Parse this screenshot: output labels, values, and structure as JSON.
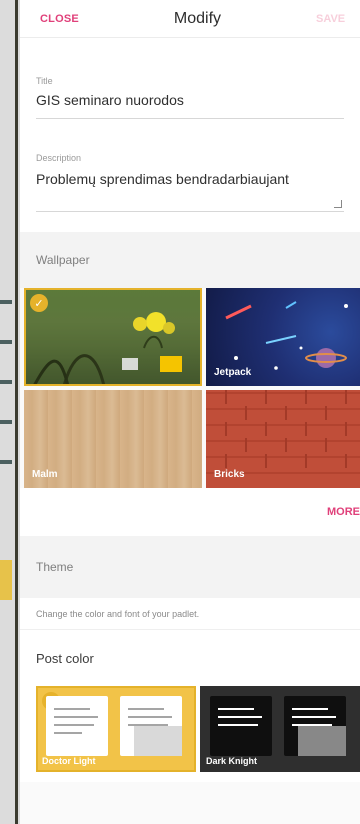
{
  "header": {
    "close_label": "CLOSE",
    "title": "Modify",
    "save_label": "SAVE"
  },
  "form": {
    "title_label": "Title",
    "title_value": "GIS seminaro nuorodos",
    "description_label": "Description",
    "description_value": "Problemų sprendimas bendradarbiaujant"
  },
  "wallpaper": {
    "heading": "Wallpaper",
    "tiles": [
      {
        "name": "",
        "selected": true
      },
      {
        "name": "Jetpack"
      },
      {
        "name": "Malm"
      },
      {
        "name": "Bricks"
      }
    ],
    "more_label": "MORE"
  },
  "theme": {
    "heading": "Theme",
    "description": "Change the color and font of your padlet.",
    "post_color_label": "Post color",
    "cards": [
      {
        "name": "Doctor Light",
        "selected": true
      },
      {
        "name": "Dark Knight"
      }
    ]
  },
  "colors": {
    "accent": "#e0407a",
    "selected": "#e4b22b"
  }
}
